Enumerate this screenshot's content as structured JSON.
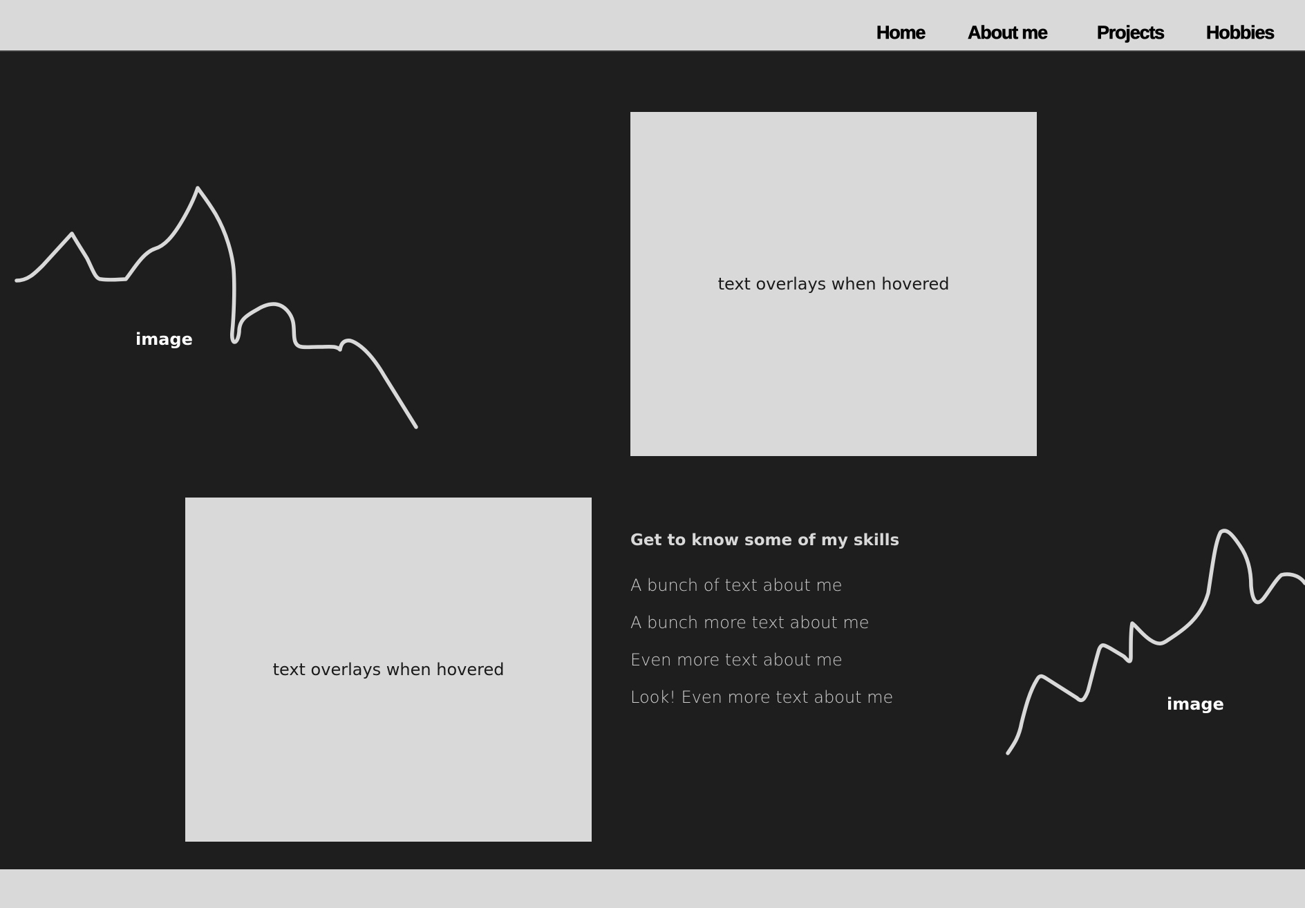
{
  "nav": {
    "items": [
      {
        "label": "Home"
      },
      {
        "label": "About me"
      },
      {
        "label": "Projects"
      },
      {
        "label": "Hobbies"
      }
    ]
  },
  "images": {
    "left_label": "image",
    "right_label": "image"
  },
  "cards": {
    "top_label": "text overlays when hovered",
    "bottom_label": "text overlays when hovered"
  },
  "skills": {
    "heading": "Get to know some of my skills",
    "items": [
      "A bunch of text about me",
      "A bunch more text about me",
      "Even more text about me",
      "Look! Even more text about me"
    ]
  },
  "colors": {
    "background": "#1e1e1e",
    "panel": "#d9d9d9",
    "nav_text": "#000000",
    "body_text": "#d0d0d0"
  },
  "icons": {
    "left_image": "squiggle-line-image-icon",
    "right_image": "squiggle-line-image-icon"
  }
}
